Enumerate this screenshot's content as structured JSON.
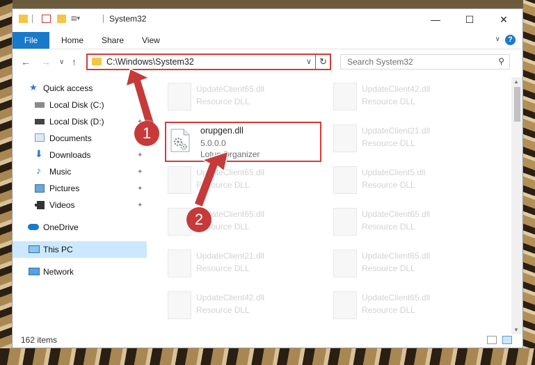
{
  "window": {
    "title": "System32",
    "minimize": "—",
    "maximize": "☐",
    "close": "✕"
  },
  "ribbon": {
    "file": "File",
    "tabs": [
      "Home",
      "Share",
      "View"
    ],
    "collapse": "∨",
    "help": "?"
  },
  "nav": {
    "back": "←",
    "forward": "→",
    "recent": "∨",
    "up": "↑",
    "address": "C:\\Windows\\System32",
    "address_dropdown": "∨",
    "refresh": "↻",
    "search_placeholder": "Search System32",
    "search_icon": "⚲"
  },
  "sidebar": {
    "items": [
      {
        "label": "Quick access",
        "icon": "star-icon",
        "pinned": false
      },
      {
        "label": "Local Disk (C:)",
        "icon": "drive-icon",
        "pinned": false
      },
      {
        "label": "Local Disk (D:)",
        "icon": "drive-icon",
        "pinned": true
      },
      {
        "label": "Documents",
        "icon": "documents-icon",
        "pinned": true
      },
      {
        "label": "Downloads",
        "icon": "downloads-icon",
        "pinned": true
      },
      {
        "label": "Music",
        "icon": "music-icon",
        "pinned": true
      },
      {
        "label": "Pictures",
        "icon": "pictures-icon",
        "pinned": true
      },
      {
        "label": "Videos",
        "icon": "videos-icon",
        "pinned": true
      },
      {
        "label": "OneDrive",
        "icon": "cloud-icon",
        "pinned": false
      },
      {
        "label": "This PC",
        "icon": "computer-icon",
        "pinned": false,
        "selected": true
      },
      {
        "label": "Network",
        "icon": "network-icon",
        "pinned": false
      }
    ],
    "pin_glyph": "📌"
  },
  "files": {
    "left_column": [
      {
        "name": "UpdateClient65.dll",
        "type": "Resource DLL"
      },
      {
        "name": "orupgen.dll",
        "version": "5.0.0.0",
        "desc": "Lotus Organizer",
        "highlighted": true
      },
      {
        "name": "UpdateClient65.dll",
        "type": "Resource DLL"
      },
      {
        "name": "UpdateClient65.dll",
        "type": "Resource DLL"
      },
      {
        "name": "UpdateClient21.dll",
        "type": "Resource DLL"
      },
      {
        "name": "UpdateClient42.dll",
        "type": "Resource DLL"
      }
    ],
    "right_column": [
      {
        "name": "UpdateClient42.dll",
        "type": "Resource DLL"
      },
      {
        "name": "UpdateClient21.dll",
        "type": "Resource DLL"
      },
      {
        "name": "UpdateClient5.dll",
        "type": "Resource DLL"
      },
      {
        "name": "UpdateClient65.dll",
        "type": "Resource DLL"
      },
      {
        "name": "UpdateClient65.dll",
        "type": "Resource DLL"
      },
      {
        "name": "UpdateClient65.dll",
        "type": "Resource DLL"
      }
    ]
  },
  "status": {
    "count": "162 items"
  },
  "annotations": {
    "step1": "1",
    "step2": "2",
    "color": "#c63a3a"
  }
}
